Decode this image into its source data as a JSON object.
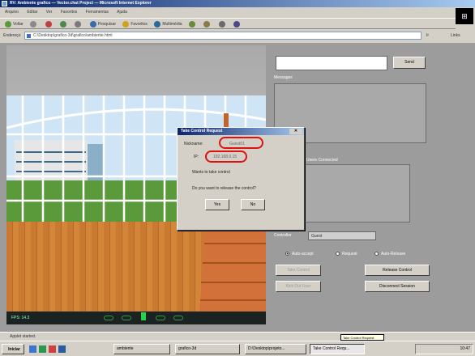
{
  "window": {
    "title": "RV: Ambiente grafico — Vector.chat Project — Microsoft Internet Explorer",
    "logo": "⊞"
  },
  "menu": [
    "Arquivo",
    "Editar",
    "Ver",
    "Favoritos",
    "Ferramentas",
    "Ajuda"
  ],
  "toolbar": {
    "back": "Voltar",
    "search": "Pesquisar",
    "favorites": "Favoritos",
    "multimedia": "Multimédia"
  },
  "address": {
    "label": "Endereço",
    "value": "C:\\Desktop\\grafico-3d\\grafico\\ambiente.html",
    "go": "Ir",
    "links": "Links"
  },
  "scene": {
    "status": "FPS: 14.3"
  },
  "panel": {
    "send": "Send",
    "messages_label": "Messages",
    "users_label": "Users Connected",
    "controller_label": "Controller",
    "controller_value": "Guest",
    "radio_auto": "Auto-accept",
    "radio_request": "Request",
    "radio_auto_release": "Auto-Release",
    "take_control": "Take Control",
    "release_control": "Release Control",
    "kick_out": "Kick Out User",
    "disconnect": "Disconnect Session"
  },
  "dialog": {
    "title": "Take Control Request",
    "nickname_label": "Nickname:",
    "nickname_value": "Guest01",
    "ip_label": "IP:",
    "ip_value": "192.168.0.15",
    "wants": "Wants to take control",
    "question": "Do you want to release the control?",
    "yes": "Yes",
    "no": "No",
    "close_icon": "close-icon"
  },
  "ie_status": "Applet started.",
  "taskbar": {
    "start": "Iniciar",
    "tasks": [
      "ambiente",
      "grafico-3d",
      "D:\\Desktop\\projeto...",
      "Take Control Requ..."
    ],
    "tooltip": "Take Control Request",
    "clock": "10:47"
  },
  "colors": {
    "highlight": "#e01010",
    "title_gradient_start": "#0a246a",
    "title_gradient_end": "#a6caf0"
  }
}
